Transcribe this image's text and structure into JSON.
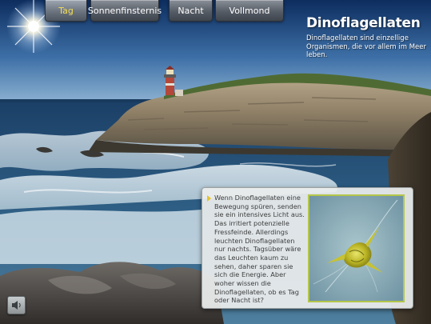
{
  "nav": {
    "tabs": [
      {
        "label": "Tag",
        "active": true
      },
      {
        "label": "Sonnenfinsternis",
        "active": false
      },
      {
        "label": "Nacht",
        "active": false
      },
      {
        "label": "Vollmond",
        "active": false
      }
    ]
  },
  "header": {
    "title": "Dinoflagellaten",
    "subtitle": "Dinoflagellaten sind einzellige Organismen, die vor allem im Meer leben."
  },
  "info": {
    "text": "Wenn Dinoflagellaten eine Bewegung spüren, senden sie ein intensives Licht aus. Das irritiert potenzielle Fressfeinde. Allerdings leuchten Dinoflagellaten nur nachts. Tagsüber wäre das Leuchten kaum zu sehen, daher sparen sie sich die Energie. Aber woher wissen die Dinoflagellaten, ob es Tag oder Nacht ist?"
  },
  "colors": {
    "active_tab_text": "#f2dd55",
    "tab_text": "#ffffff",
    "panel_border_accent": "#b4c64a",
    "bullet": "#e6c42a"
  },
  "icons": {
    "sound": "speaker-icon",
    "bullet": "arrow-right-icon",
    "sun": "sun-icon"
  }
}
